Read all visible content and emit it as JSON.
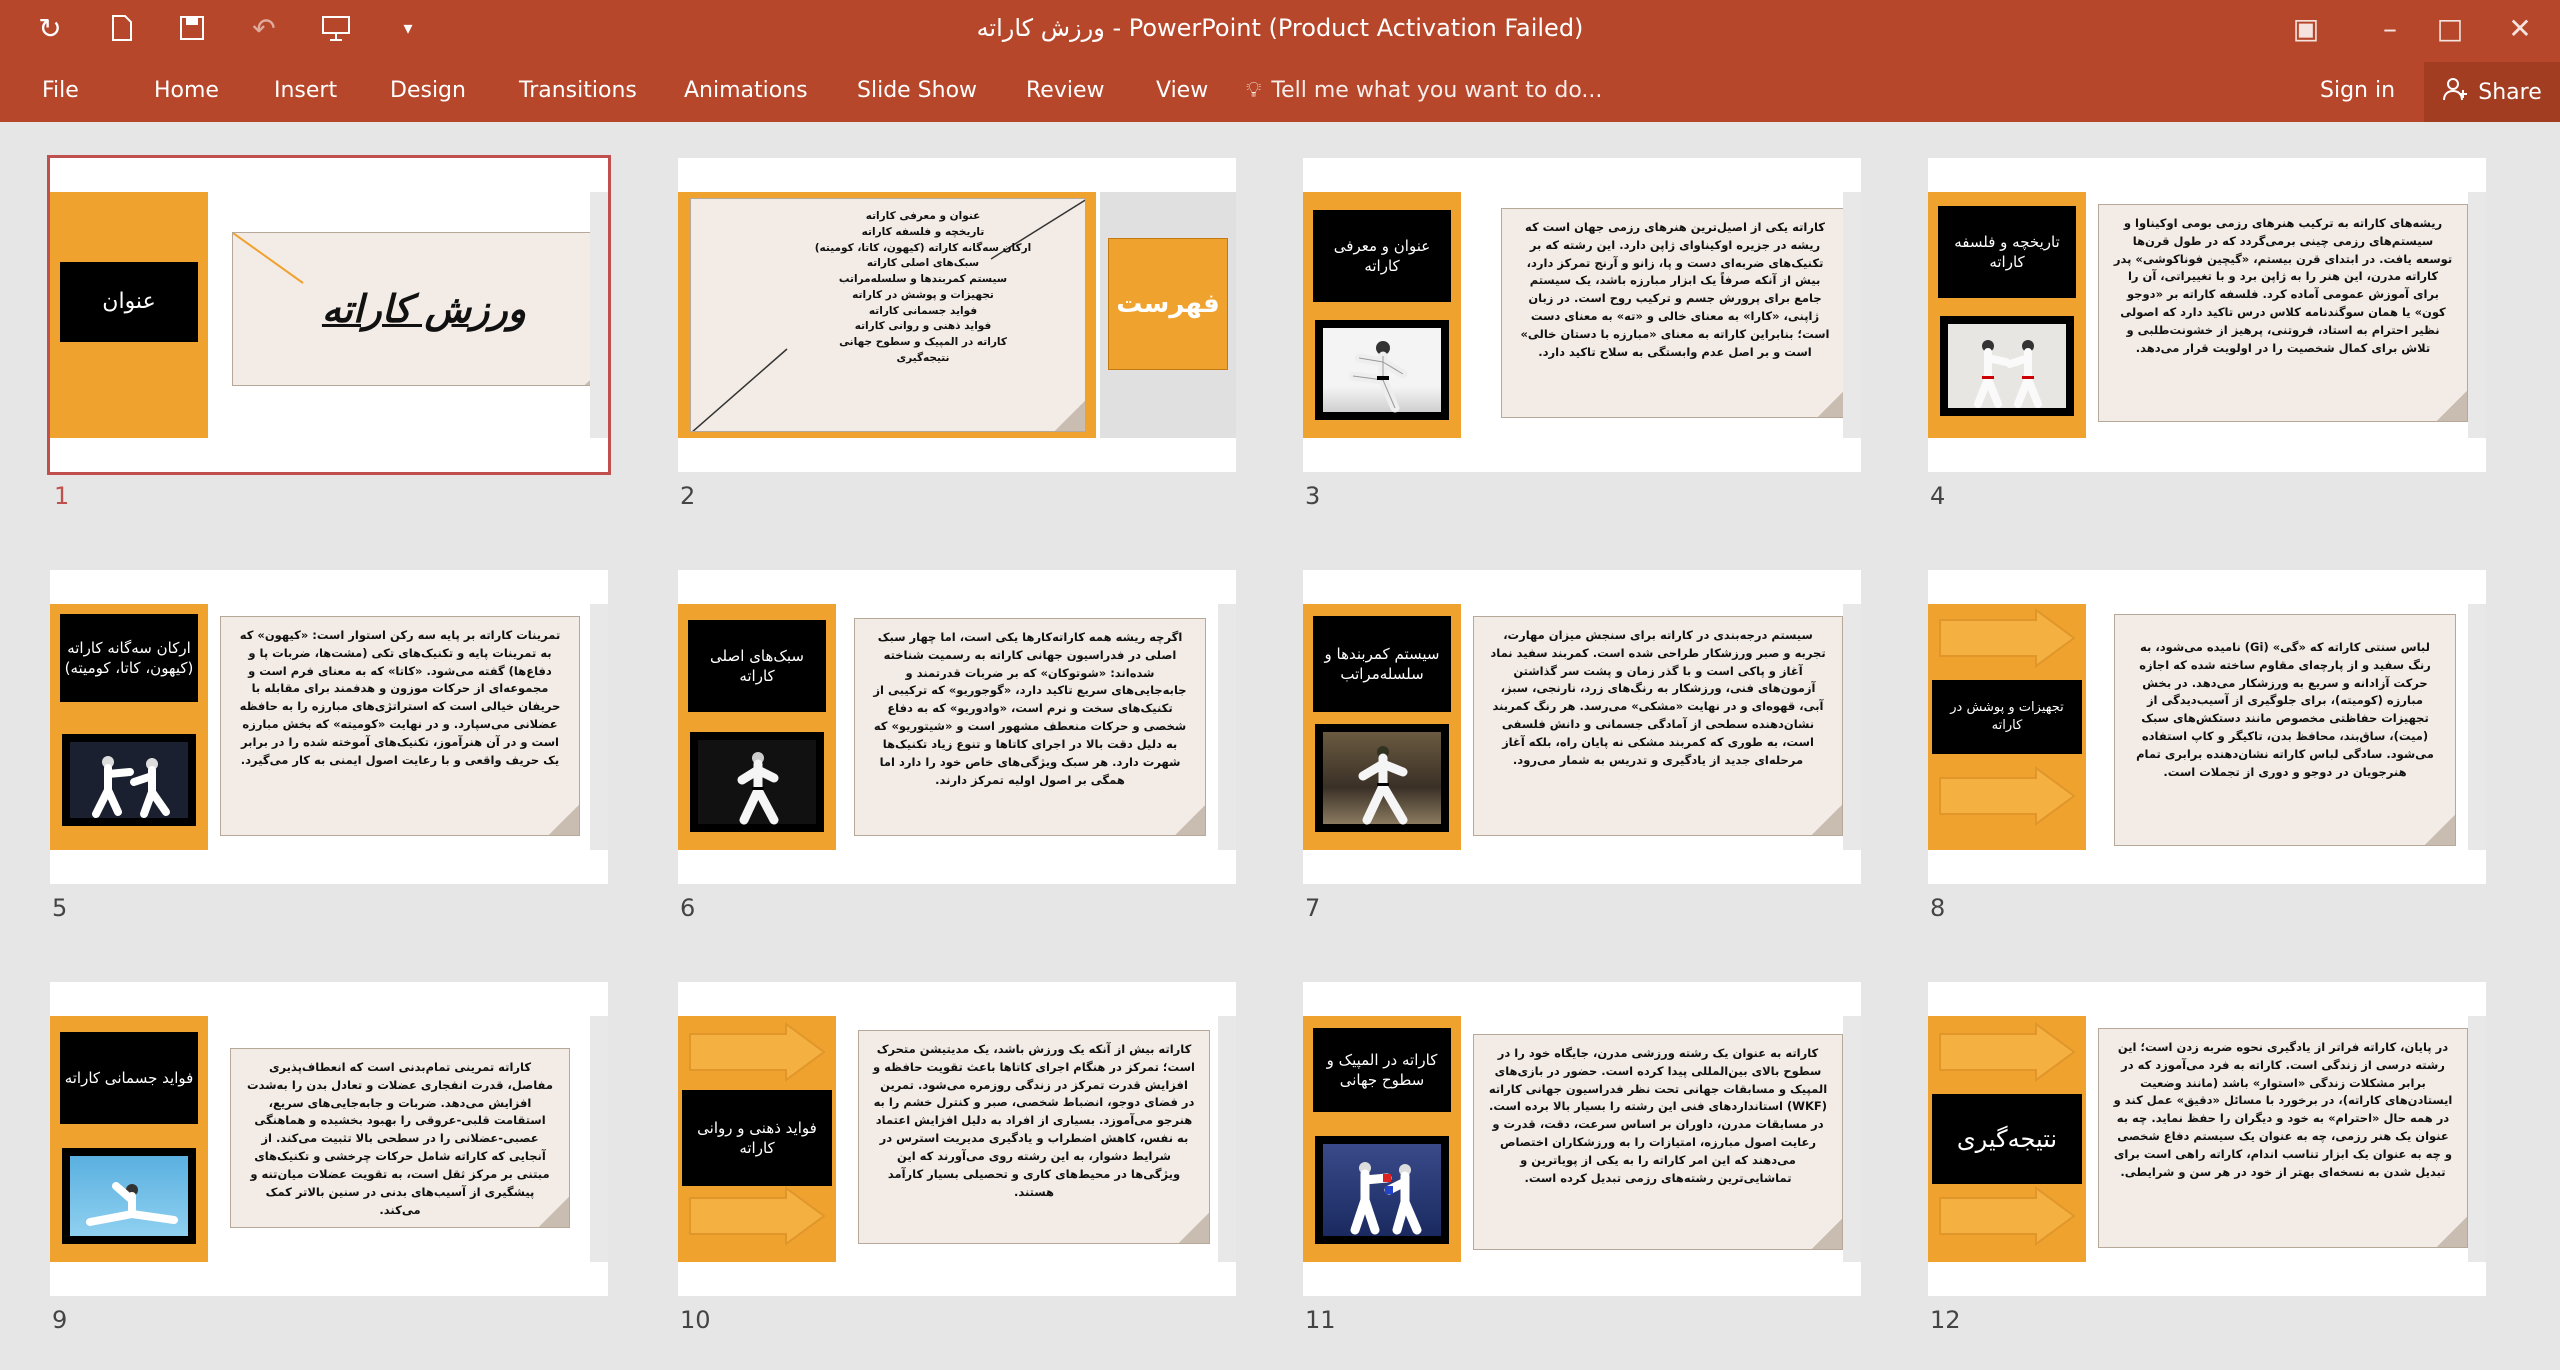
{
  "app": {
    "window_title": "ورزش کاراته - PowerPoint (Product Activation Failed)",
    "accent_color": "#b7472a",
    "qat_icons": [
      "refresh-icon",
      "new-file-icon",
      "save-icon",
      "undo-icon",
      "present-icon",
      "customize-icon"
    ]
  },
  "tabs": [
    "File",
    "Home",
    "Insert",
    "Design",
    "Transitions",
    "Animations",
    "Slide Show",
    "Review",
    "View"
  ],
  "tell_me": "Tell me what you want to do...",
  "sign_in": "Sign in",
  "share": "Share",
  "slides": [
    {
      "number": "1",
      "label": "عنوان",
      "title": "ورزش کاراته",
      "selected": true
    },
    {
      "number": "2",
      "label": "فهرست",
      "items": [
        "عنوان و معرفی کاراته",
        "تاریخچه و فلسفه کاراته",
        "ارکان سه‌گانه کاراته (کیهون، کاتا، کومیته)",
        "سبک‌های اصلی کاراته",
        "سیستم کمربندها و سلسله‌مراتب",
        "تجهیزات و پوشش در کاراته",
        "فواید جسمانی کاراته",
        "فواید ذهنی و روانی کاراته",
        "کاراته در المپیک و سطوح جهانی",
        "نتیجه‌گیری"
      ]
    },
    {
      "number": "3",
      "label": "عنوان و معرفی کاراته",
      "text": "کاراته یکی از اصیل‌ترین هنرهای رزمی جهان است که ریشه در جزیره اوکیناوای ژاپن دارد. این رشته که بر تکنیک‌های ضربه‌ای دست و پا، زانو و آرنج تمرکز دارد، بیش از آنکه صرفاً یک ابزار مبارزه باشد، یک سیستم جامع برای پرورش جسم و ترکیب روح است. در زبان ژاپنی، «کارا» به معنای خالی و «ته» به معنای دست است؛ بنابراین کاراته به معنای «مبارزه با دستان خالی» است و بر اصل عدم وابستگی به سلاح تاکید دارد."
    },
    {
      "number": "4",
      "label": "تاریخچه و فلسفه کاراته",
      "text": "ریشه‌های کاراته به ترکیب هنرهای رزمی بومی اوکیناوا و سیستم‌های رزمی چینی برمی‌گردد که در طول قرن‌ها توسعه یافت. در ابتدای قرن بیستم، «گیچین فوناکوشی» پدر کاراته مدرن، این هنر را به ژاپن برد و با تغییراتی، آن را برای آموزش عمومی آماده کرد. فلسفه کاراته بر «دوجو کون» یا همان سوگندنامه کلاس درس تاکید دارد که اصولی نظیر احترام به استاد، فروتنی، پرهیز از خشونت‌طلبی و تلاش برای کمال شخصیت را در اولویت قرار می‌دهد."
    },
    {
      "number": "5",
      "label": "ارکان سه‌گانه کاراته (کیهون، کاتا، کومیته)",
      "text": "تمرینات کاراته بر پایه سه رکن استوار است: «کیهون» که به تمرینات پایه و تکنیک‌های تکی (مشت‌ها، ضربات پا و دفاع‌ها) گفته می‌شود. «کاتا» که به معنای فرم است و مجموعه‌ای از حرکات موزون و هدفمند برای مقابله با حریفان خیالی است که استراتژی‌های مبارزه را به حافظه عضلانی می‌سپارد. و در نهایت «کومیته» که بخش مبارزه است و در آن هنرآموز، تکنیک‌های آموخته شده را در برابر یک حریف واقعی و با رعایت اصول ایمنی به کار می‌گیرد."
    },
    {
      "number": "6",
      "label": "سبک‌های اصلی کاراته",
      "text": "اگرچه ریشه همه کاراته‌کارها یکی است، اما چهار سبک اصلی در فدراسیون جهانی کاراته به رسمیت شناخته شده‌اند: «شوتوکان» که بر ضربات قدرتمند و جابه‌جایی‌های سریع تاکید دارد، «گوجوریو» که ترکیبی از تکنیک‌های سخت و نرم است، «وادوریو» که به دفاع شخصی و حرکات منعطف مشهور است و «شیتوریو» که به دلیل دقت بالا در اجرای کاتاها و تنوع زیاد تکنیک‌ها شهرت دارد. هر سبک ویژگی‌های خاص خود را دارد اما همگی بر اصول اولیه تمرکز دارند."
    },
    {
      "number": "7",
      "label": "سیستم کمربندها و سلسله‌مراتب",
      "text": "سیستم درجه‌بندی در کاراته برای سنجش میزان مهارت، تجربه و صبر ورزشکار طراحی شده است. کمربند سفید نماد آغاز و پاکی است و با گذر زمان و پشت سر گذاشتن آزمون‌های فنی، ورزشکار به رنگ‌های زرد، نارنجی، سبز، آبی، قهوه‌ای و در نهایت «مشکی» می‌رسد. هر رنگ کمربند نشان‌دهنده سطحی از آمادگی جسمانی و دانش فلسفی است، به طوری که کمربند مشکی نه پایان راه، بلکه آغاز مرحله‌ای جدید از یادگیری و تدریس به شمار می‌رود."
    },
    {
      "number": "8",
      "label": "تجهیزات و پوشش در کاراته",
      "text": "لباس سنتی کاراته که «گی» (Gi) نامیده می‌شود، به رنگ سفید و از پارچه‌ای مقاوم ساخته شده که اجازه حرکت آزادانه و سریع به ورزشکار می‌دهد. در بخش مبارزه (کومیته)، برای جلوگیری از آسیب‌دیدگی از تجهیزات حفاظتی مخصوص مانند دستکش‌های سبک (میت)، ساق‌بند، محافظ بدن، تاکیگر و کاپ استفاده می‌شود. سادگی لباس کاراته نشان‌دهنده برابری تمام هنرجویان در دوجو و دوری از تجملات است."
    },
    {
      "number": "9",
      "label": "فواید جسمانی کاراته",
      "text": "کاراته تمرینی تمام‌بدنی است که انعطاف‌پذیری مفاصل، قدرت انفجاری عضلات و تعادل بدن را به‌شدت افزایش می‌دهد. ضربات و جابه‌جایی‌های سریع، استقامت قلبی-عروقی را بهبود بخشیده و هماهنگی عصبی-عضلانی را در سطحی بالا تثبیت می‌کند. از آنجایی که کاراته شامل حرکات چرخشی و تکنیک‌های مبتنی بر مرکز ثقل است، به تقویت عضلات میان‌تنه و پیشگیری از آسیب‌های بدنی در سنین بالاتر کمک می‌کند."
    },
    {
      "number": "10",
      "label": "فواید ذهنی و روانی کاراته",
      "text": "کاراته بیش از آنکه یک ورزش باشد، یک مدیتیشن متحرک است؛ تمرکز در هنگام اجرای کاتاها باعث تقویت حافظه و افزایش قدرت تمرکز در زندگی روزمره می‌شود. تمرین در فضای دوجو، انضباط شخصی، صبر و کنترل خشم را به هنرجو می‌آموزد. بسیاری از افراد به دلیل افزایش اعتماد به نفس، کاهش اضطراب و یادگیری مدیریت استرس در شرایط دشوار، به این رشته روی می‌آورند که این ویژگی‌ها در محیط‌های کاری و تحصیلی بسیار کارآمد هستند."
    },
    {
      "number": "11",
      "label": "کاراته در المپیک و سطوح جهانی",
      "text": "کاراته به عنوان یک رشته ورزشی مدرن، جایگاه خود را در سطوح بالای بین‌المللی پیدا کرده است. حضور در بازی‌های المپیک و مسابقات جهانی تحت نظر فدراسیون جهانی کاراته (WKF) استانداردهای فنی این رشته را بسیار بالا برده است. در مسابقات مدرن، داوران بر اساس سرعت، دقت، قدرت و رعایت اصول مبارزه، امتیازات را به ورزشکاران اختصاص می‌دهند که این امر کاراته را به یکی از پویاترین و تماشایی‌ترین رشته‌های رزمی تبدیل کرده است."
    },
    {
      "number": "12",
      "label": "نتیجه‌گیری",
      "text": "در پایان، کاراته فراتر از یادگیری نحوه ضربه زدن است؛ این رشته درسی از زندگی است. کاراته به فرد می‌آموزد که در برابر مشکلات زندگی «استوار» باشد (مانند وضعیت ایستادن‌های کاراته)، در برخورد با مسائل «دقیق» عمل کند و در همه حال «احترام» به خود و دیگران را حفظ نماید. چه به عنوان یک هنر رزمی، چه به عنوان یک سیستم دفاع شخصی و چه به عنوان یک ابزار تناسب اندام، کاراته راهی است برای تبدیل شدن به نسخه‌ای بهتر از خود در هر سن و شرایطی."
    }
  ]
}
